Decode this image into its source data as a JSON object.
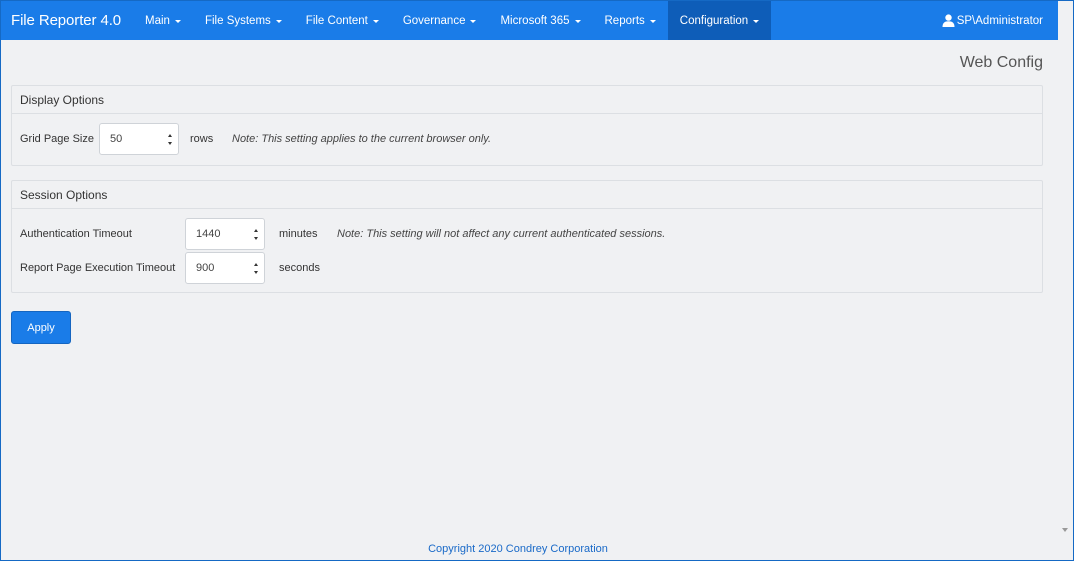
{
  "navbar": {
    "brand": "File Reporter 4.0",
    "items": [
      {
        "label": "Main"
      },
      {
        "label": "File Systems"
      },
      {
        "label": "File Content"
      },
      {
        "label": "Governance"
      },
      {
        "label": "Microsoft 365"
      },
      {
        "label": "Reports"
      },
      {
        "label": "Configuration",
        "active": true
      }
    ],
    "user": "SP\\Administrator"
  },
  "page": {
    "title": "Web Config"
  },
  "display_options": {
    "heading": "Display Options",
    "grid_page_size": {
      "label": "Grid Page Size",
      "value": "50",
      "unit": "rows",
      "note": "Note: This setting applies to the current browser only."
    }
  },
  "session_options": {
    "heading": "Session Options",
    "auth_timeout": {
      "label": "Authentication Timeout",
      "value": "1440",
      "unit": "minutes",
      "note": "Note: This setting will not affect any current authenticated sessions."
    },
    "report_timeout": {
      "label": "Report Page Execution Timeout",
      "value": "900",
      "unit": "seconds"
    }
  },
  "actions": {
    "apply_label": "Apply"
  },
  "footer": {
    "copyright": "Copyright 2020 Condrey Corporation"
  },
  "colors": {
    "navbar": "#1a7ce8",
    "navbar_active": "#0e5db8",
    "background": "#f0f1f3",
    "link": "#1a6ac8"
  }
}
